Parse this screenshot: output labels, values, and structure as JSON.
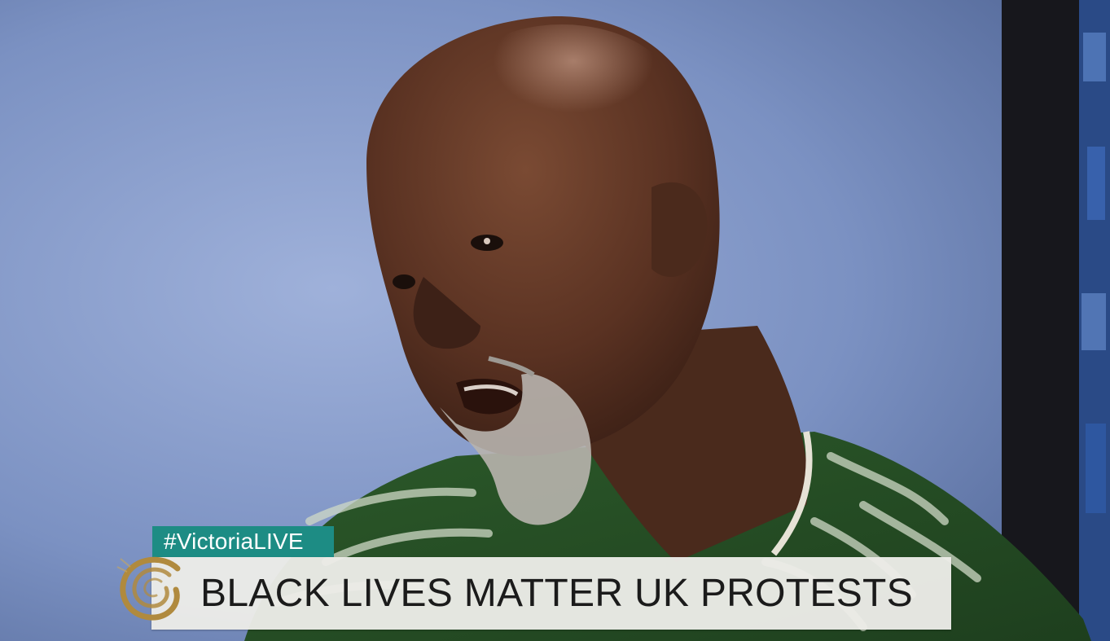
{
  "broadcast": {
    "hashtag": "#VictoriaLIVE",
    "headline": "BLACK LIVES MATTER UK PROTESTS"
  },
  "colors": {
    "hashtag_bg": "#1d8c84",
    "strap_bg": "#ecece8",
    "headline_text": "#1b1b1b",
    "logo_gold": "#b08a3e"
  },
  "icons": {
    "logo": "swirl-logo-icon"
  }
}
